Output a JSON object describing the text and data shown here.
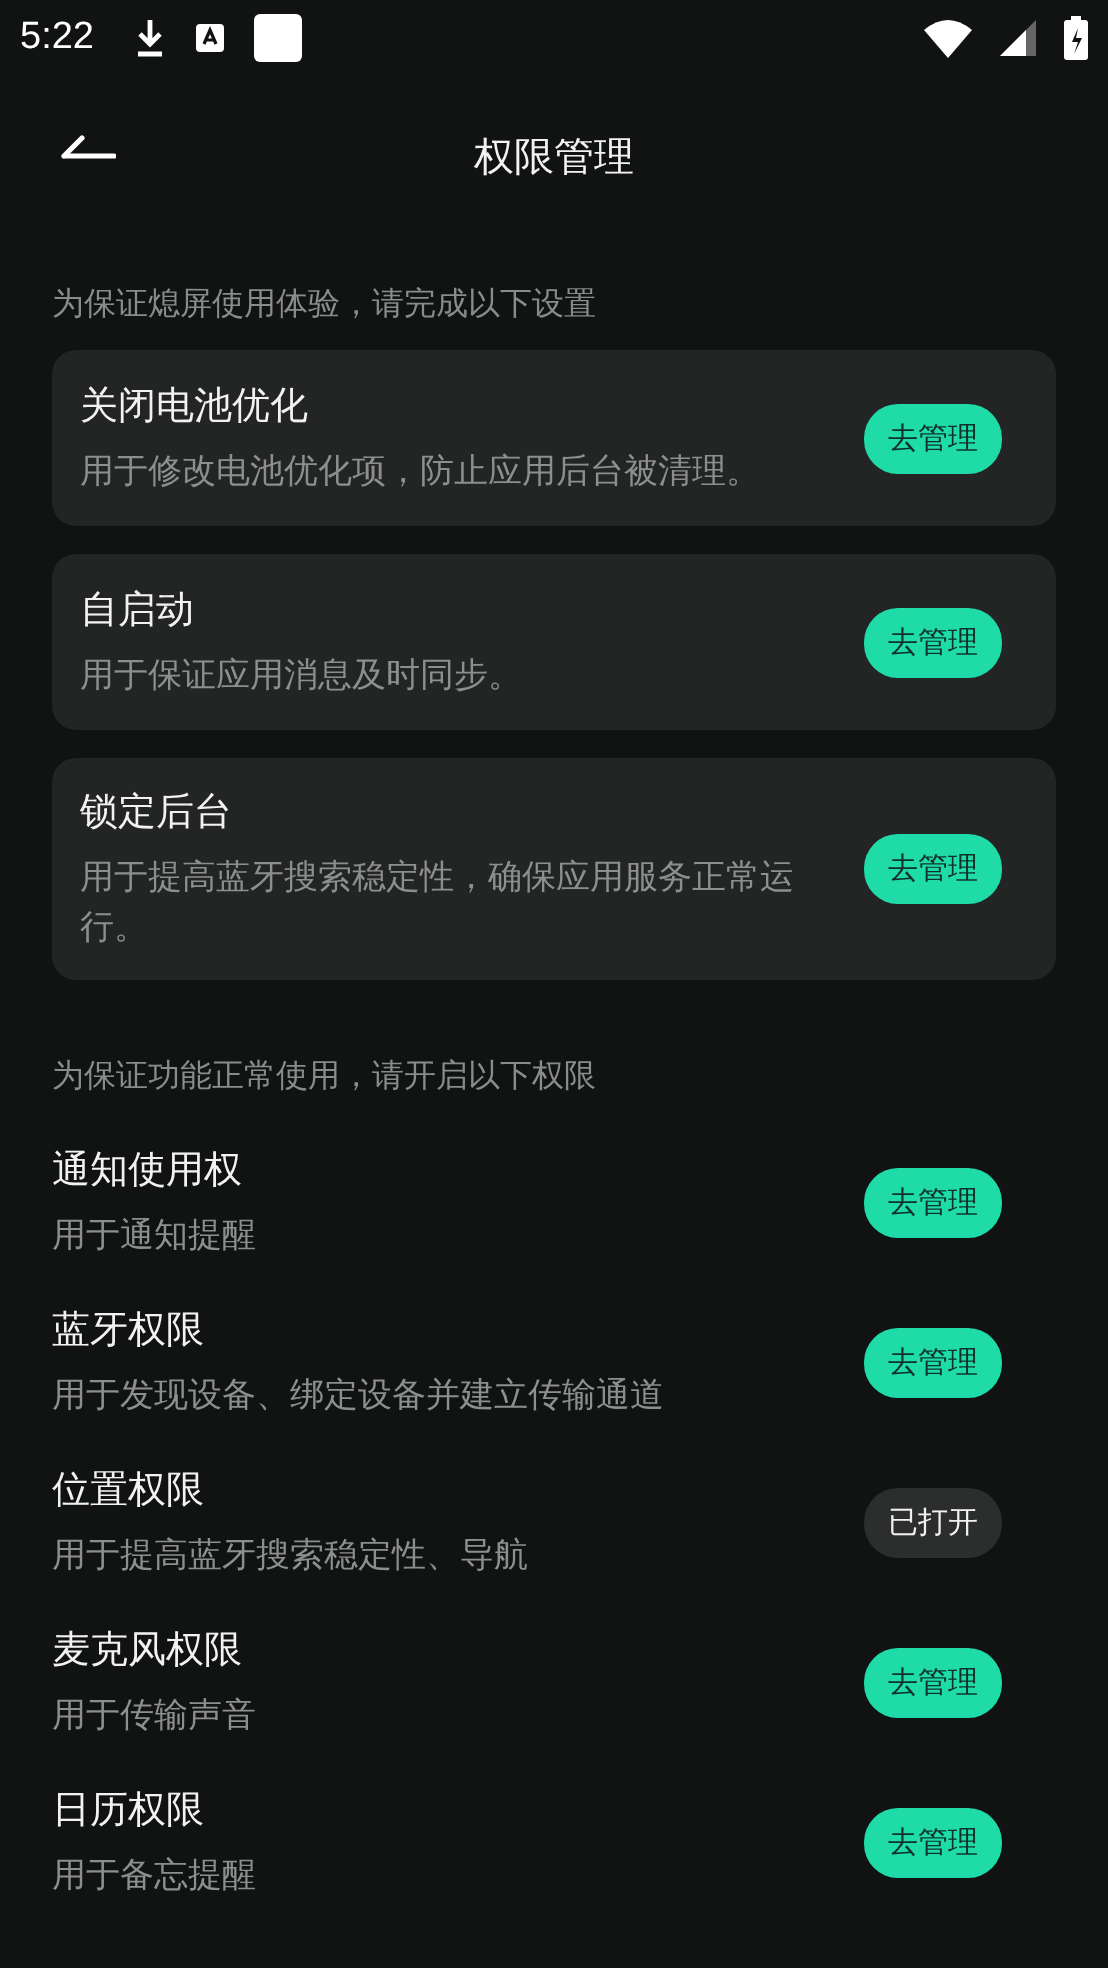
{
  "status_bar": {
    "time": "5:22"
  },
  "header": {
    "title": "权限管理"
  },
  "sections": [
    {
      "label": "为保证熄屏使用体验，请完成以下设置",
      "kind": "card",
      "items": [
        {
          "title": "关闭电池优化",
          "description": "用于修改电池优化项，防止应用后台被清理。",
          "button": {
            "label": "去管理",
            "kind": "action"
          }
        },
        {
          "title": "自启动",
          "description": "用于保证应用消息及时同步。",
          "button": {
            "label": "去管理",
            "kind": "action"
          }
        },
        {
          "title": "锁定后台",
          "description": "用于提高蓝牙搜索稳定性，确保应用服务正常运行。",
          "button": {
            "label": "去管理",
            "kind": "action"
          }
        }
      ]
    },
    {
      "label": "为保证功能正常使用，请开启以下权限",
      "kind": "plain",
      "items": [
        {
          "title": "通知使用权",
          "description": "用于通知提醒",
          "button": {
            "label": "去管理",
            "kind": "action"
          }
        },
        {
          "title": "蓝牙权限",
          "description": "用于发现设备、绑定设备并建立传输通道",
          "button": {
            "label": "去管理",
            "kind": "action"
          }
        },
        {
          "title": "位置权限",
          "description": "用于提高蓝牙搜索稳定性、导航",
          "button": {
            "label": "已打开",
            "kind": "done"
          }
        },
        {
          "title": "麦克风权限",
          "description": "用于传输声音",
          "button": {
            "label": "去管理",
            "kind": "action"
          }
        },
        {
          "title": "日历权限",
          "description": "用于备忘提醒",
          "button": {
            "label": "去管理",
            "kind": "action"
          }
        }
      ]
    }
  ]
}
